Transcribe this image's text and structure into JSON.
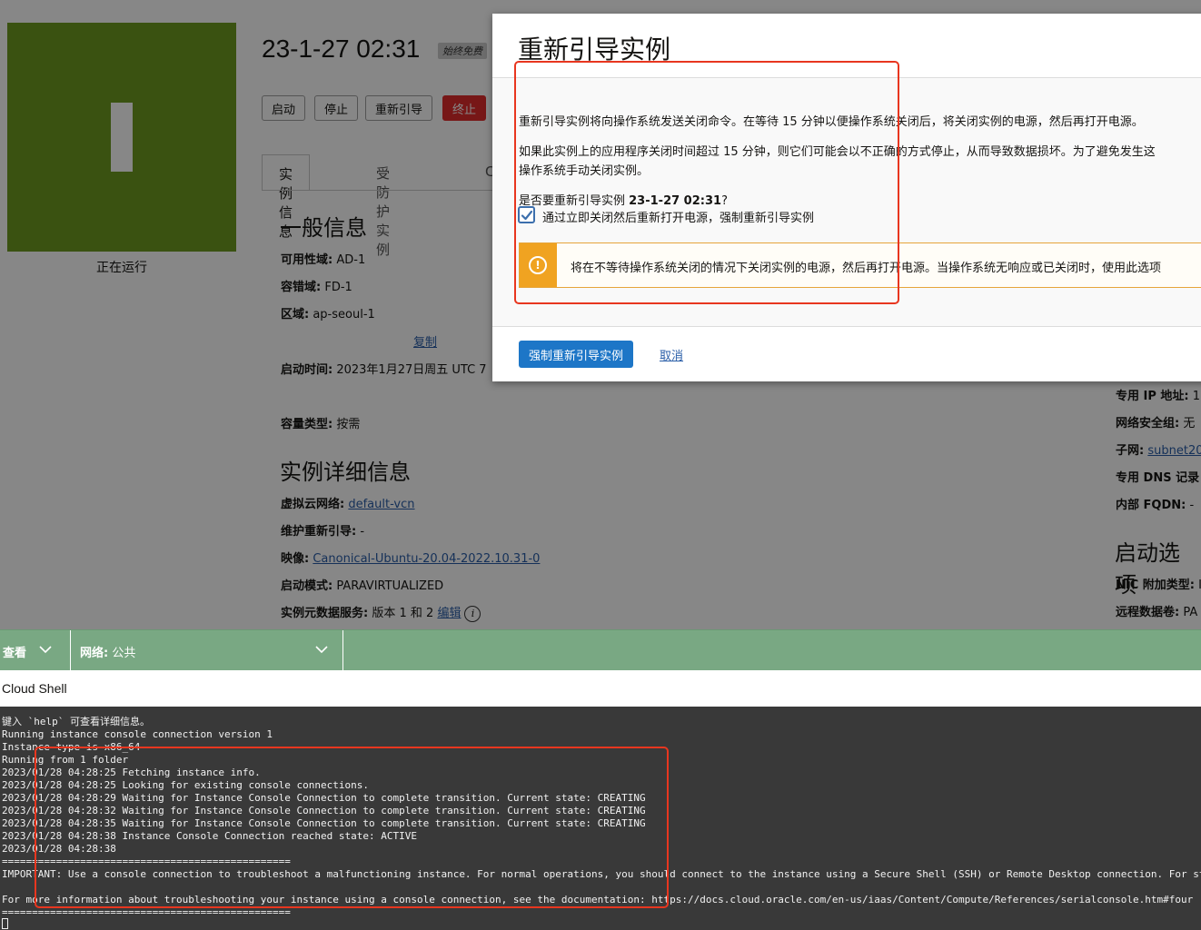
{
  "instance": {
    "name": "23-1-27 02:31",
    "free_badge": "始终免费",
    "status": "正在运行",
    "actions": [
      "启动",
      "停止",
      "重新引导",
      "终止"
    ]
  },
  "tabs": [
    "实例信息",
    "受防护实例",
    "C"
  ],
  "general_info": {
    "heading": "一般信息",
    "availability_domain": {
      "label": "可用性域:",
      "value": "AD-1"
    },
    "fault_domain": {
      "label": "容错域:",
      "value": "FD-1"
    },
    "region": {
      "label": "区域:",
      "value": "ap-seoul-1"
    },
    "copy_link": "复制",
    "launch_time": {
      "label": "启动时间:",
      "value": "2023年1月27日周五 UTC 7"
    },
    "capacity_type": {
      "label": "容量类型:",
      "value": "按需"
    }
  },
  "instance_details": {
    "heading": "实例详细信息",
    "vcn": {
      "label": "虚拟云网络:",
      "value": "default-vcn"
    },
    "maintenance": {
      "label": "维护重新引导:",
      "value": "-"
    },
    "image": {
      "label": "映像:",
      "value": "Canonical-Ubuntu-20.04-2022.10.31-0"
    },
    "launch_mode": {
      "label": "启动模式:",
      "value": "PARAVIRTUALIZED"
    },
    "metadata": {
      "label": "实例元数据服务:",
      "value": "版本 1 和 2",
      "edit": "编辑"
    }
  },
  "right_column": {
    "private_ip": {
      "label": "专用 IP 地址:",
      "value": "1("
    },
    "nsg": {
      "label": "网络安全组:",
      "value": "无"
    },
    "subnet": {
      "label": "子网:",
      "value": "subnet20"
    },
    "dns": {
      "label": "专用 DNS 记录"
    },
    "fqdn": {
      "label": "内部 FQDN:",
      "value": "-"
    },
    "launch_options_heading": "启动选项",
    "nic": {
      "label": "NIC 附加类型:",
      "value": "I"
    },
    "remote_volume": {
      "label": "远程数据卷:",
      "value": "PA"
    }
  },
  "modal": {
    "title": "重新引导实例",
    "para1": "重新引导实例将向操作系统发送关闭命令。在等待 15 分钟以便操作系统关闭后，将关闭实例的电源，然后再打开电源。",
    "para2_line1": "如果此实例上的应用程序关闭时间超过 15 分钟，则它们可能会以不正确的方式停止，从而导致数据损坏。为了避免发生这",
    "para2_line2": "操作系统手动关闭实例。",
    "confirm_prefix": "是否要重新引导实例 ",
    "confirm_name": "23-1-27 02:31",
    "confirm_suffix": "?",
    "checkbox_label": "通过立即关闭然后重新打开电源，强制重新引导实例",
    "checkbox_checked": true,
    "warning": "将在不等待操作系统关闭的情况下关闭实例的电源，然后再打开电源。当操作系统无响应或已关闭时，使用此选项",
    "primary_button": "强制重新引导实例",
    "cancel": "取消"
  },
  "toolbar": {
    "view_label": "查看",
    "network_label": "网络:",
    "network_value": "公共"
  },
  "cloud_shell": {
    "title": "Cloud Shell",
    "lines": [
      "键入 `help` 可查看详细信息。",
      "Running instance console connection version 1",
      "Instance type is x86_64",
      "Running from 1 folder",
      "2023/01/28 04:28:25 Fetching instance info.",
      "2023/01/28 04:28:25 Looking for existing console connections.",
      "2023/01/28 04:28:29 Waiting for Instance Console Connection to complete transition. Current state: CREATING",
      "2023/01/28 04:28:32 Waiting for Instance Console Connection to complete transition. Current state: CREATING",
      "2023/01/28 04:28:35 Waiting for Instance Console Connection to complete transition. Current state: CREATING",
      "2023/01/28 04:28:38 Instance Console Connection reached state: ACTIVE",
      "2023/01/28 04:28:38",
      "================================================",
      "IMPORTANT: Use a console connection to troubleshoot a malfunctioning instance. For normal operations, you should connect to the instance using a Secure Shell (SSH) or Remote Desktop connection. For steps, see https://docs",
      "",
      "For more information about troubleshooting your instance using a console connection, see the documentation: https://docs.cloud.oracle.com/en-us/iaas/Content/Compute/References/serialconsole.htm#four",
      "================================================"
    ]
  },
  "colors": {
    "accent": "#1d76c7",
    "danger": "#e02c2c",
    "warning": "#f0a321",
    "running": "#6e9b20",
    "toolbar": "#79a883",
    "terminal_bg": "#393939",
    "annotation": "#e8361f"
  }
}
